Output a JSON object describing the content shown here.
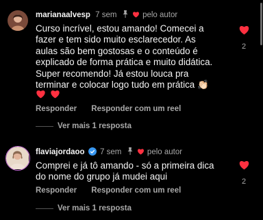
{
  "colors": {
    "background": "#000000",
    "text": "#f5f5f5",
    "secondary": "#a8a8a8",
    "heart": "#ff3040",
    "verified": "#3897f0"
  },
  "comments": [
    {
      "username": "marianaalvesp",
      "time": "7 sem",
      "pin_icon": "pin-icon",
      "liked_by_author": "pelo autor",
      "text": "Curso incrível, estou amando! Comecei a\nfazer e tem sido muito esclarecedor. As\naulas são bem gostosas e o conteúdo é\nexplicado de forma prática e muito didática.\nSuper recomendo! Já estou louca pra\nterminar e colocar logo tudo em prática 👏🏻",
      "emojis": [
        "heart-emoji",
        "heart-emoji"
      ],
      "reply_label": "Responder",
      "reel_reply_label": "Responder com um reel",
      "view_replies": "Ver mais 1 resposta",
      "like_count": "2"
    },
    {
      "username": "flaviajordaoo",
      "verified": true,
      "time": "7 sem",
      "pin_icon": "pin-icon",
      "liked_by_author": "pelo autor",
      "text": "Comprei e já tô amando - só a primeira dica\ndo nome do grupo já mudei aqui",
      "reply_label": "Responder",
      "reel_reply_label": "Responder com um reel",
      "view_replies": "Ver mais 1 resposta",
      "like_count": "2"
    }
  ]
}
